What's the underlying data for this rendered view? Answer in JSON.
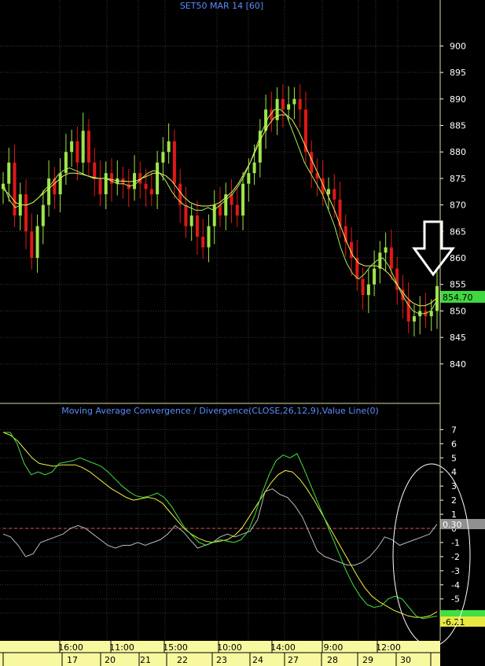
{
  "colors": {
    "background": "#000000",
    "grid": "#3a3a3a",
    "axis_divider": "#d8d8a0",
    "bull_candle": "#9ee64a",
    "bear_candle": "#e01818",
    "ma_green": "#a8f060",
    "ma_yellow": "#f0f060",
    "macd_line": "#40e040",
    "signal_line": "#f0f040",
    "histogram_line": "#b8b8b8",
    "zero_line": "#e05050",
    "title_text": "#5a8cff",
    "axis_text": "#ffffff",
    "price_badge": "#40d840",
    "macd_badge": "#40e040",
    "signal_badge": "#e8e840",
    "value_badge": "#909090",
    "annotation": "#ffffff",
    "date_axis_bg": "#f8f8a0"
  },
  "chart_data": [
    {
      "type": "candlestick",
      "title": "SET50 MAR 14   [60]",
      "ylim": [
        833,
        906
      ],
      "yticks": [
        840,
        845,
        850,
        855,
        860,
        865,
        870,
        875,
        880,
        885,
        890,
        895,
        900
      ],
      "last_price_label": "854.70",
      "series_close": [
        874,
        878,
        868,
        872,
        865,
        860,
        866,
        870,
        875,
        872,
        876,
        880,
        882,
        878,
        884,
        878,
        875,
        872,
        876,
        874,
        875,
        874,
        873,
        876,
        874,
        873,
        872,
        878,
        880,
        882,
        874,
        870,
        866,
        868,
        864,
        862,
        866,
        870,
        868,
        872,
        870,
        868,
        874,
        876,
        878,
        884,
        888,
        886,
        890,
        888,
        889,
        890,
        888,
        880,
        876,
        875,
        872,
        873,
        871,
        866,
        863,
        860,
        856,
        853,
        855,
        858,
        861,
        862,
        858,
        854,
        852,
        848,
        849,
        850,
        849,
        850,
        854.7
      ],
      "ma_green": [
        874,
        871,
        869.5,
        870,
        870,
        870.5,
        871.5,
        873,
        874,
        875.5,
        876.5,
        877,
        876.5,
        876,
        875.5,
        875,
        875,
        875,
        874.5,
        874,
        874,
        873.5,
        874,
        875,
        876,
        876.5,
        876,
        874.5,
        872.5,
        871,
        870,
        869.5,
        869,
        869,
        869.5,
        869,
        870,
        871,
        872,
        873.5,
        875.5,
        878,
        881,
        884,
        886.5,
        888,
        888,
        887,
        884,
        881,
        878,
        876,
        874,
        872,
        869,
        866,
        862,
        859,
        857,
        856,
        857,
        858.5,
        859.5,
        860,
        858.5,
        856,
        853.5,
        851.5,
        850,
        849.5,
        849.5,
        850,
        852
      ],
      "ma_yellow": [
        873,
        872,
        870.5,
        870,
        870,
        870.5,
        871.5,
        872.5,
        873.5,
        874.5,
        875.5,
        876,
        876,
        875.8,
        875.5,
        875.2,
        875,
        875,
        874.8,
        874.5,
        874.5,
        874.4,
        874.5,
        875,
        875.5,
        876,
        876,
        875.5,
        874.5,
        873,
        871.5,
        870.5,
        870,
        869.8,
        869.8,
        870,
        870.5,
        871.5,
        872.5,
        874,
        876,
        878,
        880.5,
        883,
        885,
        886.5,
        887,
        887,
        886,
        884,
        881.5,
        879,
        876.5,
        874,
        871.5,
        869,
        866,
        863,
        860.5,
        859,
        858.5,
        858.5,
        858.5,
        858,
        857,
        855.5,
        854,
        852.5,
        851.5,
        851,
        851,
        851.5,
        852.5
      ]
    },
    {
      "type": "line",
      "title": "Moving Average Convergence / Divergence(CLOSE,26,12,9),Value Line(0)",
      "ylim": [
        -7.8,
        7.8
      ],
      "yticks": [
        7,
        6,
        5,
        4,
        3,
        2,
        1,
        0,
        -1,
        -2,
        -3,
        -4,
        -5,
        -6
      ],
      "value_label": "0.30",
      "macd_label": "-6.21",
      "macd_values": [
        6.8,
        6.8,
        6.0,
        4.6,
        3.8,
        4.0,
        3.8,
        4.0,
        4.6,
        4.7,
        4.8,
        5.0,
        4.8,
        4.6,
        4.4,
        4.0,
        3.5,
        3.0,
        2.6,
        2.3,
        2.2,
        2.3,
        2.5,
        2.2,
        1.6,
        0.8,
        0.0,
        -0.5,
        -1.0,
        -1.2,
        -1.0,
        -0.8,
        -0.9,
        -1.0,
        -0.8,
        -0.2,
        1.0,
        2.5,
        3.8,
        4.8,
        5.2,
        5.0,
        5.3,
        4.2,
        3.0,
        1.8,
        0.6,
        -0.6,
        -1.8,
        -3.0,
        -4.0,
        -4.8,
        -5.4,
        -5.6,
        -5.5,
        -5.0,
        -4.8,
        -5.0,
        -5.6,
        -6.2,
        -6.4,
        -6.3,
        -6.21
      ],
      "signal_values": [
        6.8,
        6.6,
        6.2,
        5.6,
        5.0,
        4.6,
        4.5,
        4.4,
        4.5,
        4.5,
        4.5,
        4.3,
        4.0,
        3.6,
        3.2,
        2.8,
        2.5,
        2.2,
        2.0,
        2.1,
        2.2,
        2.1,
        1.8,
        1.2,
        0.6,
        0.0,
        -0.4,
        -0.7,
        -0.9,
        -1.0,
        -0.9,
        -0.8,
        -0.5,
        0.0,
        0.8,
        1.6,
        2.4,
        3.2,
        3.8,
        4.1,
        4.0,
        3.5,
        2.8,
        2.0,
        1.1,
        0.2,
        -0.7,
        -1.6,
        -2.5,
        -3.4,
        -4.2,
        -4.8,
        -5.2,
        -5.5,
        -5.8,
        -6.0,
        -6.2,
        -6.3,
        -6.3,
        -6.2,
        -5.9
      ],
      "hist_values": [
        -0.4,
        -0.6,
        -1.2,
        -2.0,
        -1.8,
        -1.0,
        -0.8,
        -0.6,
        -0.4,
        0.0,
        0.2,
        0.0,
        -0.4,
        -0.8,
        -1.2,
        -1.4,
        -1.2,
        -1.2,
        -1.0,
        -1.2,
        -1.0,
        -0.8,
        -0.4,
        0.2,
        -0.2,
        -0.8,
        -1.4,
        -1.2,
        -1.0,
        -0.6,
        -0.4,
        -0.6,
        -0.4,
        -0.2,
        0.6,
        2.6,
        2.8,
        2.4,
        2.2,
        1.6,
        0.8,
        -0.4,
        -1.6,
        -2.0,
        -2.2,
        -2.4,
        -2.6,
        -2.6,
        -2.4,
        -2.0,
        -1.4,
        -0.6,
        -0.8,
        -1.2,
        -1.0,
        -0.8,
        -0.6,
        -0.4,
        0.3
      ]
    }
  ],
  "time_axis": {
    "time_labels": [
      "16:00",
      "11:00",
      "15:00",
      "10:00",
      "14:00",
      "9:00",
      "12:00"
    ],
    "date_labels": [
      "17",
      "20",
      "21",
      "22",
      "23",
      "24",
      "27",
      "28",
      "29",
      "30"
    ]
  }
}
